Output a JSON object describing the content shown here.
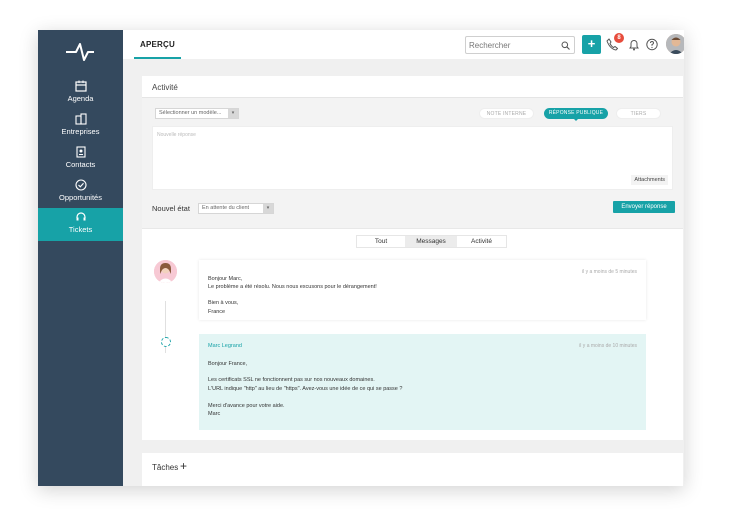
{
  "sidebar": {
    "items": [
      {
        "label": "Agenda",
        "icon": "calendar-icon"
      },
      {
        "label": "Entreprises",
        "icon": "building-icon"
      },
      {
        "label": "Contacts",
        "icon": "contact-book-icon"
      },
      {
        "label": "Opportunités",
        "icon": "check-circle-icon"
      },
      {
        "label": "Tickets",
        "icon": "headset-icon"
      }
    ],
    "active": "Tickets"
  },
  "topbar": {
    "tab": "APERÇU",
    "search_placeholder": "Rechercher",
    "add_label": "+",
    "call_badge": "8"
  },
  "activity": {
    "title": "Activité",
    "template_select": "Sélectionner un modèle...",
    "reply_types": [
      "NOTE INTERNE",
      "RÉPONSE PUBLIQUE",
      "TIERS"
    ],
    "reply_type_active": "RÉPONSE PUBLIQUE",
    "reply_placeholder": "Nouvelle réponse",
    "attachments_label": "Attachments",
    "state_label": "Nouvel état",
    "state_value": "En attente du client",
    "send_label": "Envoyer réponse",
    "filters": [
      "Tout",
      "Messages",
      "Activité"
    ],
    "filter_active": "Messages"
  },
  "messages": [
    {
      "time": "il y a moins de 5 minutes",
      "lines": [
        "Bonjour Marc,",
        "Le problème a été résolu. Nous nous excusons pour le dérangement!",
        "Bien à vous,",
        "France"
      ]
    },
    {
      "author": "Marc Legrand",
      "time": "il y a moins de 10 minutes",
      "lines": [
        "Bonjour France,",
        "Les certificats SSL ne fonctionnent pas sur nos nouveaux domaines.",
        "L'URL indique \"http\" au lieu de \"https\". Avez-vous une idée de ce qui se passe ?",
        "Merci d'avance pour votre aide.",
        "Marc"
      ]
    }
  ],
  "tasks": {
    "title": "Tâches",
    "add_label": "+"
  },
  "colors": {
    "sidebar": "#34495e",
    "accent": "#17a2a7",
    "badge": "#e74c3c"
  }
}
